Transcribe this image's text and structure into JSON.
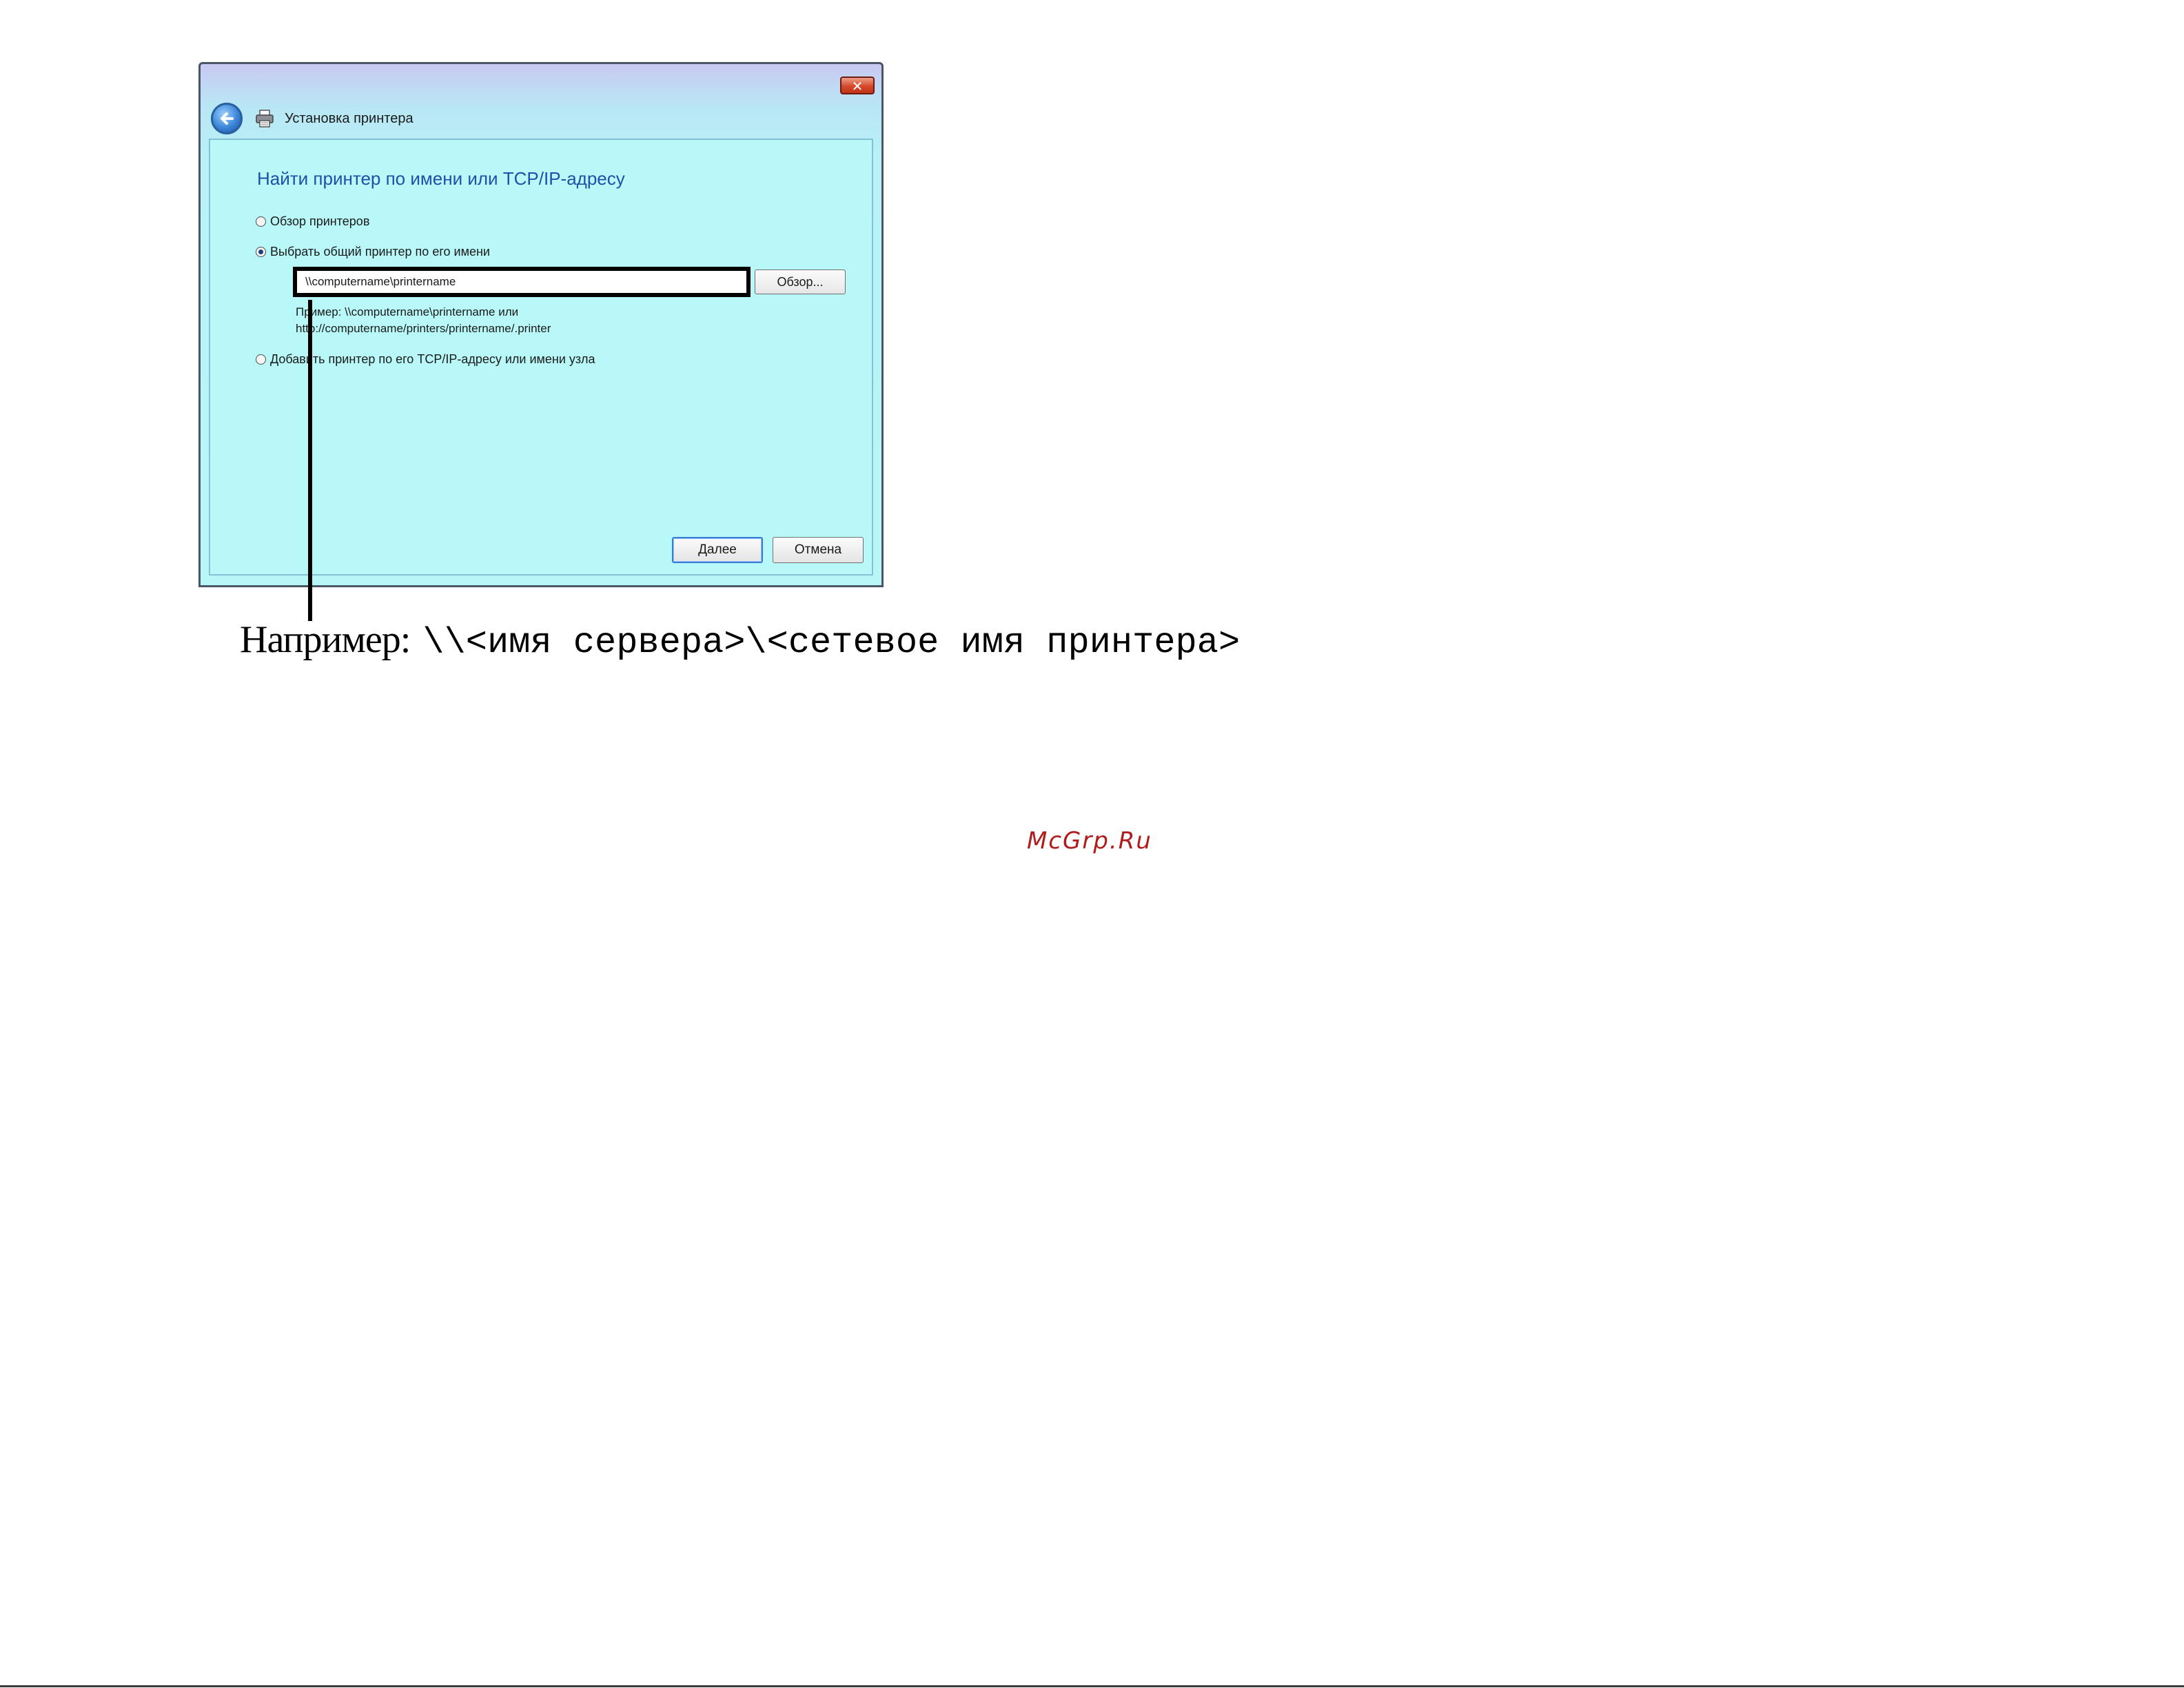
{
  "window": {
    "title": "Установка принтера",
    "close_label": "✕"
  },
  "dialog": {
    "heading": "Найти принтер по имени или  TCP/IP-адресу",
    "options": [
      {
        "label": "Обзор принтеров",
        "checked": false
      },
      {
        "label": "Выбрать общий принтер по его имени",
        "checked": true
      },
      {
        "label": "Добавить принтер по его TCP/IP-адресу или имени узла",
        "checked": false
      }
    ],
    "path_value": "\\\\computername\\printername",
    "browse_label": "Обзор...",
    "example_line1": "Пример: \\\\computername\\printername или",
    "example_line2": "http://computername/printers/printername/.printer",
    "next_label": "Далее",
    "cancel_label": "Отмена"
  },
  "caption": {
    "label": "Например:",
    "code": "\\\\<имя сервера>\\<сетевое имя принтера>"
  },
  "watermark": "McGrp.Ru",
  "colors": {
    "heading": "#1f4fa8",
    "content_bg": "#b9f8f8",
    "watermark": "#b01c1c"
  },
  "icons": {
    "back": "back-arrow-icon",
    "printer": "printer-icon",
    "close": "close-icon"
  }
}
